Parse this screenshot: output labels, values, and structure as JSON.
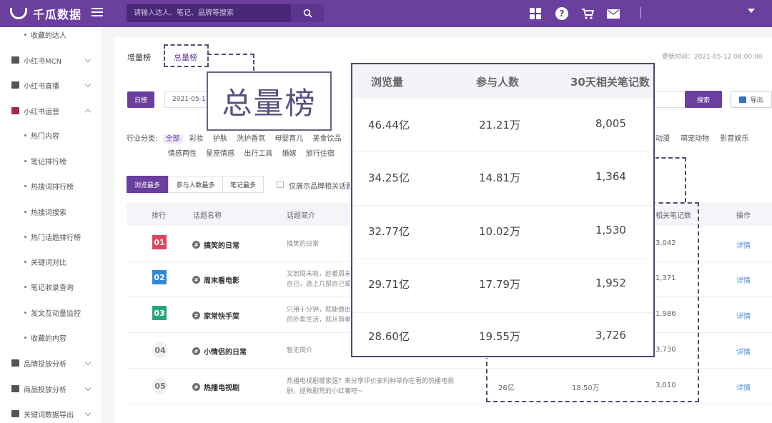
{
  "header": {
    "logo_text": "千瓜数据",
    "search_placeholder": "请输入达人、笔记、品牌等搜索",
    "icons": [
      "grid-icon",
      "help-icon",
      "cart-icon",
      "mail-icon",
      "user-caret-icon"
    ],
    "help_glyph": "?"
  },
  "sidebar": {
    "items": [
      {
        "label": "收藏的达人",
        "type": "sub"
      },
      {
        "label": "小红书MCN",
        "type": "group",
        "expanded": false
      },
      {
        "label": "小红书直播",
        "type": "group",
        "expanded": false
      },
      {
        "label": "小红书运营",
        "type": "group",
        "expanded": true
      },
      {
        "label": "热门内容",
        "type": "sub"
      },
      {
        "label": "笔记排行榜",
        "type": "sub"
      },
      {
        "label": "热搜词排行榜",
        "type": "sub"
      },
      {
        "label": "热搜词搜索",
        "type": "sub"
      },
      {
        "label": "热门话题排行榜",
        "type": "sub"
      },
      {
        "label": "关键词对比",
        "type": "sub"
      },
      {
        "label": "笔记收录查询",
        "type": "sub"
      },
      {
        "label": "发文互动量监控",
        "type": "sub"
      },
      {
        "label": "收藏的内容",
        "type": "sub"
      },
      {
        "label": "品牌投放分析",
        "type": "group",
        "expanded": false
      },
      {
        "label": "商品投放分析",
        "type": "group",
        "expanded": false
      },
      {
        "label": "关键词数据导出",
        "type": "group",
        "expanded": false
      }
    ]
  },
  "page": {
    "tabs": [
      {
        "label": "增量榜"
      },
      {
        "label": "总量榜"
      }
    ],
    "active_tab": "总量榜",
    "update_time": "更新时间：2021-05-12 08:00:00",
    "period_button": "日榜",
    "date_value": "2021-05-11",
    "search_button": "搜索",
    "export_button": "导出",
    "callout_text": "总量榜",
    "industry_label": "行业分类:",
    "industry_row1": [
      "全部",
      "彩妆",
      "护肤",
      "洗护香氛",
      "母婴育儿",
      "美食饮品"
    ],
    "industry_row1_right": [
      "动漫",
      "萌宠动物",
      "影音娱乐"
    ],
    "industry_row2": [
      "情感两性",
      "星座情感",
      "出行工具",
      "婚嫁",
      "旅行住宿"
    ],
    "sort_tabs": [
      "浏览最多",
      "参与人数最多",
      "笔记最多"
    ],
    "brand_only_label": "仅展示品牌相关话题",
    "detail_label": "详情"
  },
  "table": {
    "headers": [
      "排行",
      "话题名称",
      "话题简介",
      "相关笔记数",
      "操作"
    ],
    "rows": [
      {
        "rank": "01",
        "name": "搞笑的日常",
        "intro": [
          "搞笑的日常"
        ],
        "notes": "3,042"
      },
      {
        "rank": "02",
        "name": "周末看电影",
        "intro": [
          "又到周末啦，趁着周末",
          "自己，选上几部自己爱"
        ],
        "notes": "1,371"
      },
      {
        "rank": "03",
        "name": "家常快手菜",
        "intro": [
          "只用十分钟，就能做出",
          "的外卖生活，就从简单"
        ],
        "notes": "1,986"
      },
      {
        "rank": "04",
        "name": "小情侣的日常",
        "intro": [
          "暂无简介"
        ],
        "notes": "3,730"
      },
      {
        "rank": "05",
        "name": "热播电视剧",
        "intro": [
          "热播电视剧哪家强？来分享评价安利种草你在看的热播电视",
          "剧，拯救剧荒的小红薯吧~"
        ],
        "views": "26亿",
        "participants": "18.50万",
        "notes": "3,010"
      }
    ]
  },
  "overlay": {
    "headers": [
      "浏览量",
      "参与人数",
      "30天相关笔记数"
    ],
    "rows": [
      [
        "46.44亿",
        "21.21万",
        "8,005"
      ],
      [
        "34.25亿",
        "14.81万",
        "1,364"
      ],
      [
        "32.77亿",
        "10.02万",
        "1,530"
      ],
      [
        "29.71亿",
        "17.79万",
        "1,952"
      ],
      [
        "28.60亿",
        "19.55万",
        "3,726"
      ]
    ]
  },
  "colors": {
    "brand": "#6a3f9e",
    "rank1": "#e0455d",
    "rank2": "#2f8ad8",
    "rank3": "#27a77a",
    "link": "#4a8ed8"
  }
}
